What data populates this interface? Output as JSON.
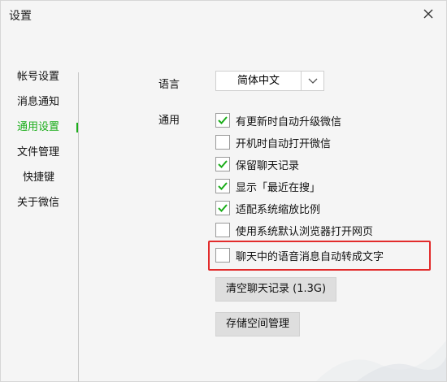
{
  "window": {
    "title": "设置",
    "close_icon": "close-icon"
  },
  "sidebar": {
    "items": [
      {
        "label": "帐号设置",
        "active": false
      },
      {
        "label": "消息通知",
        "active": false
      },
      {
        "label": "通用设置",
        "active": true
      },
      {
        "label": "文件管理",
        "active": false
      },
      {
        "label": "快捷键",
        "active": false
      },
      {
        "label": "关于微信",
        "active": false
      }
    ],
    "active_color": "#1aad19"
  },
  "main": {
    "language": {
      "label": "语言",
      "selected": "简体中文",
      "dropdown_icon": "chevron-down-icon"
    },
    "general": {
      "label": "通用",
      "options": [
        {
          "label": "有更新时自动升级微信",
          "checked": true
        },
        {
          "label": "开机时自动打开微信",
          "checked": false
        },
        {
          "label": "保留聊天记录",
          "checked": true
        },
        {
          "label": "显示「最近在搜」",
          "checked": true
        },
        {
          "label": "适配系统缩放比例",
          "checked": true
        },
        {
          "label": "使用系统默认浏览器打开网页",
          "checked": false
        },
        {
          "label": "聊天中的语音消息自动转成文字",
          "checked": false
        }
      ]
    },
    "buttons": {
      "clear_history": "清空聊天记录 (1.3G)",
      "storage_manage": "存储空间管理"
    },
    "highlight_color": "#e22b2b"
  }
}
